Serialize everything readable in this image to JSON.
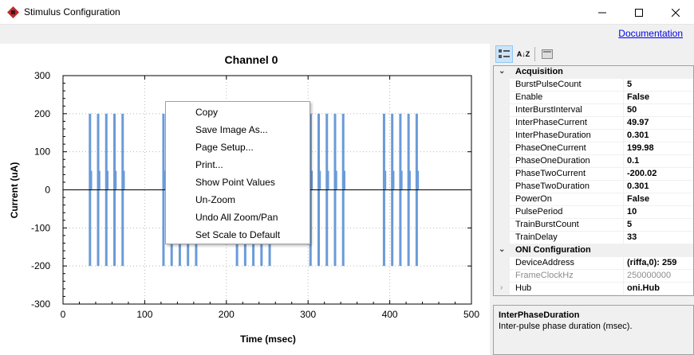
{
  "window": {
    "title": "Stimulus Configuration",
    "minimize": "—",
    "maximize": "☐",
    "close": "✕"
  },
  "documentation_link": "Documentation",
  "chart_data": {
    "type": "line",
    "title": "Channel 0",
    "xlabel": "Time (msec)",
    "ylabel": "Current (uA)",
    "xlim": [
      0,
      500
    ],
    "ylim": [
      -300,
      300
    ],
    "xticks": [
      "0",
      "100",
      "200",
      "300",
      "400",
      "500"
    ],
    "yticks": [
      "300",
      "200",
      "100",
      "0",
      "-100",
      "-200",
      "-300"
    ],
    "grid": true,
    "series": [
      {
        "color": "#6a9bd8",
        "pulse_times": [
          33,
          43,
          53,
          63,
          73,
          123,
          133,
          143,
          153,
          163,
          213,
          223,
          233,
          243,
          253,
          303,
          313,
          323,
          333,
          343,
          393,
          403,
          413,
          423,
          433
        ],
        "phase_one_current": 199.98,
        "phase_two_current": -200.02,
        "inter_phase_current": 49.97
      }
    ],
    "baseline": 0
  },
  "context_menu": {
    "items": [
      "Copy",
      "Save Image As...",
      "Page Setup...",
      "Print...",
      "Show Point Values",
      "Un-Zoom",
      "Undo All Zoom/Pan",
      "Set Scale to Default"
    ]
  },
  "toolbar": {
    "categorized_icon": "categorized-icon",
    "alphabetical_icon": "alphabetical-icon",
    "alpha_label": "A↓Z",
    "pages_icon": "property-pages-icon"
  },
  "property_grid": {
    "categories": [
      {
        "title": "Acquisition",
        "rows": [
          {
            "name": "BurstPulseCount",
            "value": "5"
          },
          {
            "name": "Enable",
            "value": "False"
          },
          {
            "name": "InterBurstInterval",
            "value": "50"
          },
          {
            "name": "InterPhaseCurrent",
            "value": "49.97"
          },
          {
            "name": "InterPhaseDuration",
            "value": "0.301"
          },
          {
            "name": "PhaseOneCurrent",
            "value": "199.98"
          },
          {
            "name": "PhaseOneDuration",
            "value": "0.1"
          },
          {
            "name": "PhaseTwoCurrent",
            "value": "-200.02"
          },
          {
            "name": "PhaseTwoDuration",
            "value": "0.301"
          },
          {
            "name": "PowerOn",
            "value": "False"
          },
          {
            "name": "PulsePeriod",
            "value": "10"
          },
          {
            "name": "TrainBurstCount",
            "value": "5"
          },
          {
            "name": "TrainDelay",
            "value": "33"
          }
        ]
      },
      {
        "title": "ONI Configuration",
        "rows": [
          {
            "name": "DeviceAddress",
            "value": "(riffa,0): 259"
          },
          {
            "name": "FrameClockHz",
            "value": "250000000"
          },
          {
            "name": "Hub",
            "value": "oni.Hub"
          }
        ]
      }
    ]
  },
  "help": {
    "title": "InterPhaseDuration",
    "description": "Inter-pulse phase duration (msec)."
  }
}
